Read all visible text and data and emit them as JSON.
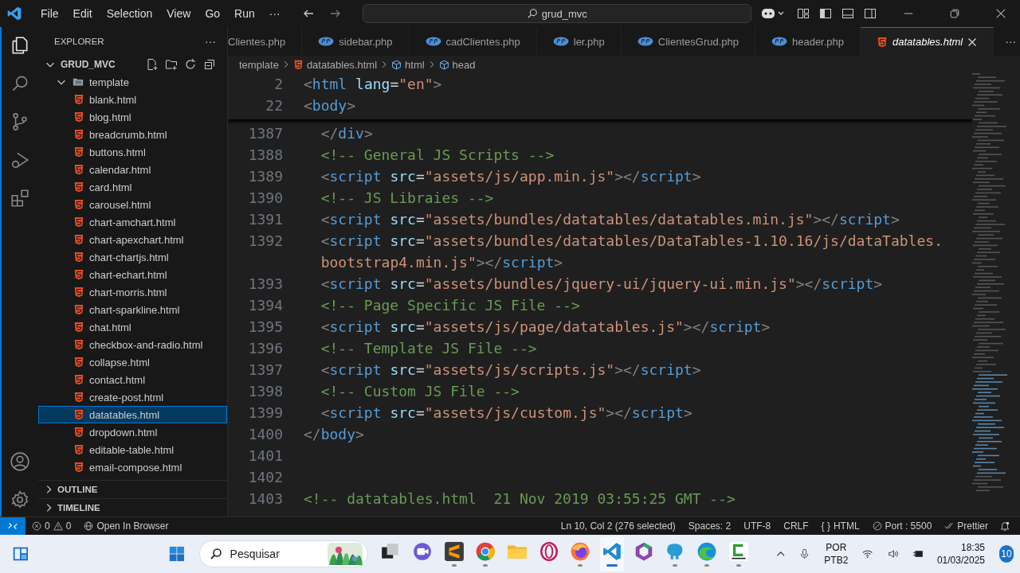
{
  "title_bar": {
    "menu": [
      "File",
      "Edit",
      "Selection",
      "View",
      "Go",
      "Run",
      "···"
    ],
    "search": "grud_mvc"
  },
  "explorer": {
    "title": "EXPLORER",
    "more": "···",
    "tree": [
      {
        "label": "GRUD_MVC",
        "kind": "root",
        "expanded": true,
        "selected": false,
        "children": [
          {
            "label": "template",
            "kind": "folder",
            "expanded": true,
            "selected": false,
            "children": [
              {
                "label": "blank.html",
                "kind": "html",
                "selected": false
              },
              {
                "label": "blog.html",
                "kind": "html",
                "selected": false
              },
              {
                "label": "breadcrumb.html",
                "kind": "html",
                "selected": false
              },
              {
                "label": "buttons.html",
                "kind": "html",
                "selected": false
              },
              {
                "label": "calendar.html",
                "kind": "html",
                "selected": false
              },
              {
                "label": "card.html",
                "kind": "html",
                "selected": false
              },
              {
                "label": "carousel.html",
                "kind": "html",
                "selected": false
              },
              {
                "label": "chart-amchart.html",
                "kind": "html",
                "selected": false
              },
              {
                "label": "chart-apexchart.html",
                "kind": "html",
                "selected": false
              },
              {
                "label": "chart-chartjs.html",
                "kind": "html",
                "selected": false
              },
              {
                "label": "chart-echart.html",
                "kind": "html",
                "selected": false
              },
              {
                "label": "chart-morris.html",
                "kind": "html",
                "selected": false
              },
              {
                "label": "chart-sparkline.html",
                "kind": "html",
                "selected": false
              },
              {
                "label": "chat.html",
                "kind": "html",
                "selected": false
              },
              {
                "label": "checkbox-and-radio.html",
                "kind": "html",
                "selected": false
              },
              {
                "label": "collapse.html",
                "kind": "html",
                "selected": false
              },
              {
                "label": "contact.html",
                "kind": "html",
                "selected": false
              },
              {
                "label": "create-post.html",
                "kind": "html",
                "selected": false
              },
              {
                "label": "datatables.html",
                "kind": "html",
                "selected": true
              },
              {
                "label": "dropdown.html",
                "kind": "html",
                "selected": false
              },
              {
                "label": "editable-table.html",
                "kind": "html",
                "selected": false
              },
              {
                "label": "email-compose.html",
                "kind": "html",
                "selected": false
              }
            ]
          }
        ]
      }
    ],
    "sections": [
      {
        "label": "OUTLINE",
        "expanded": false
      },
      {
        "label": "TIMELINE",
        "expanded": false
      }
    ]
  },
  "tabs": [
    {
      "label": "Clientes.php",
      "kind": "none",
      "selected": false,
      "preview": false
    },
    {
      "label": "sidebar.php",
      "kind": "php",
      "selected": false,
      "preview": false
    },
    {
      "label": "cadClientes.php",
      "kind": "php",
      "selected": false,
      "preview": false
    },
    {
      "label": "ler.php",
      "kind": "php",
      "selected": false,
      "preview": false
    },
    {
      "label": "ClientesGrud.php",
      "kind": "php",
      "selected": false,
      "preview": false
    },
    {
      "label": "header.php",
      "kind": "php",
      "selected": false,
      "preview": false
    },
    {
      "label": "datatables.html",
      "kind": "html",
      "selected": true,
      "preview": true
    }
  ],
  "breadcrumb": [
    {
      "label": "template",
      "kind": "folder"
    },
    {
      "label": "datatables.html",
      "kind": "html"
    },
    {
      "label": "html",
      "kind": "element"
    },
    {
      "label": "head",
      "kind": "element"
    }
  ],
  "sticky_lines": [
    {
      "number": "2",
      "tokens": [
        {
          "kind": "punct",
          "text": "<"
        },
        {
          "kind": "tag",
          "text": "html"
        },
        {
          "kind": "attr",
          "text": " lang"
        },
        {
          "kind": "plain",
          "text": "="
        },
        {
          "kind": "str",
          "text": "\"en\""
        },
        {
          "kind": "punct",
          "text": ">"
        }
      ]
    },
    {
      "number": "22",
      "tokens": [
        {
          "kind": "punct",
          "text": "<"
        },
        {
          "kind": "tag",
          "text": "body"
        },
        {
          "kind": "punct",
          "text": ">"
        }
      ]
    }
  ],
  "lines": [
    {
      "number": "1387",
      "tokens": [
        {
          "kind": "punct",
          "text": "  </"
        },
        {
          "kind": "tag",
          "text": "div"
        },
        {
          "kind": "punct",
          "text": ">"
        }
      ]
    },
    {
      "number": "1388",
      "tokens": [
        {
          "kind": "comment",
          "text": "  <!-- General JS Scripts -->"
        }
      ]
    },
    {
      "number": "1389",
      "tokens": [
        {
          "kind": "punct",
          "text": "  <"
        },
        {
          "kind": "tag",
          "text": "script"
        },
        {
          "kind": "attr",
          "text": " src"
        },
        {
          "kind": "plain",
          "text": "="
        },
        {
          "kind": "str",
          "text": "\"assets/js/app.min.js\""
        },
        {
          "kind": "punct",
          "text": "></"
        },
        {
          "kind": "tag",
          "text": "script"
        },
        {
          "kind": "punct",
          "text": ">"
        }
      ]
    },
    {
      "number": "1390",
      "tokens": [
        {
          "kind": "comment",
          "text": "  <!-- JS Libraies -->"
        }
      ]
    },
    {
      "number": "1391",
      "tokens": [
        {
          "kind": "punct",
          "text": "  <"
        },
        {
          "kind": "tag",
          "text": "script"
        },
        {
          "kind": "attr",
          "text": " src"
        },
        {
          "kind": "plain",
          "text": "="
        },
        {
          "kind": "str",
          "text": "\"assets/bundles/datatables/datatables.min.js\""
        },
        {
          "kind": "punct",
          "text": "></"
        },
        {
          "kind": "tag",
          "text": "script"
        },
        {
          "kind": "punct",
          "text": ">"
        }
      ]
    },
    {
      "number": "1392",
      "tokens": [
        {
          "kind": "punct",
          "text": "  <"
        },
        {
          "kind": "tag",
          "text": "script"
        },
        {
          "kind": "attr",
          "text": " src"
        },
        {
          "kind": "plain",
          "text": "="
        },
        {
          "kind": "str",
          "text": "\"assets/bundles/datatables/DataTables-1.10.16/js/dataTables."
        }
      ]
    },
    {
      "continuation": true,
      "tokens": [
        {
          "kind": "str",
          "text": "bootstrap4.min.js\""
        },
        {
          "kind": "punct",
          "text": "></"
        },
        {
          "kind": "tag",
          "text": "script"
        },
        {
          "kind": "punct",
          "text": ">"
        }
      ]
    },
    {
      "number": "1393",
      "tokens": [
        {
          "kind": "punct",
          "text": "  <"
        },
        {
          "kind": "tag",
          "text": "script"
        },
        {
          "kind": "attr",
          "text": " src"
        },
        {
          "kind": "plain",
          "text": "="
        },
        {
          "kind": "str",
          "text": "\"assets/bundles/jquery-ui/jquery-ui.min.js\""
        },
        {
          "kind": "punct",
          "text": "></"
        },
        {
          "kind": "tag",
          "text": "script"
        },
        {
          "kind": "punct",
          "text": ">"
        }
      ]
    },
    {
      "number": "1394",
      "tokens": [
        {
          "kind": "comment",
          "text": "  <!-- Page Specific JS File -->"
        }
      ]
    },
    {
      "number": "1395",
      "tokens": [
        {
          "kind": "punct",
          "text": "  <"
        },
        {
          "kind": "tag",
          "text": "script"
        },
        {
          "kind": "attr",
          "text": " src"
        },
        {
          "kind": "plain",
          "text": "="
        },
        {
          "kind": "str",
          "text": "\"assets/js/page/datatables.js\""
        },
        {
          "kind": "punct",
          "text": "></"
        },
        {
          "kind": "tag",
          "text": "script"
        },
        {
          "kind": "punct",
          "text": ">"
        }
      ]
    },
    {
      "number": "1396",
      "tokens": [
        {
          "kind": "comment",
          "text": "  <!-- Template JS File -->"
        }
      ]
    },
    {
      "number": "1397",
      "tokens": [
        {
          "kind": "punct",
          "text": "  <"
        },
        {
          "kind": "tag",
          "text": "script"
        },
        {
          "kind": "attr",
          "text": " src"
        },
        {
          "kind": "plain",
          "text": "="
        },
        {
          "kind": "str",
          "text": "\"assets/js/scripts.js\""
        },
        {
          "kind": "punct",
          "text": "></"
        },
        {
          "kind": "tag",
          "text": "script"
        },
        {
          "kind": "punct",
          "text": ">"
        }
      ]
    },
    {
      "number": "1398",
      "tokens": [
        {
          "kind": "comment",
          "text": "  <!-- Custom JS File -->"
        }
      ]
    },
    {
      "number": "1399",
      "tokens": [
        {
          "kind": "punct",
          "text": "  <"
        },
        {
          "kind": "tag",
          "text": "script"
        },
        {
          "kind": "attr",
          "text": " src"
        },
        {
          "kind": "plain",
          "text": "="
        },
        {
          "kind": "str",
          "text": "\"assets/js/custom.js\""
        },
        {
          "kind": "punct",
          "text": "></"
        },
        {
          "kind": "tag",
          "text": "script"
        },
        {
          "kind": "punct",
          "text": ">"
        }
      ]
    },
    {
      "number": "1400",
      "tokens": [
        {
          "kind": "punct",
          "text": "</"
        },
        {
          "kind": "tag",
          "text": "body"
        },
        {
          "kind": "punct",
          "text": ">"
        }
      ]
    },
    {
      "number": "1401"
    },
    {
      "number": "1402"
    },
    {
      "number": "1403",
      "tokens": [
        {
          "kind": "comment",
          "text": "<!-- datatables.html  21 Nov 2019 03:55:25 GMT -->"
        }
      ]
    }
  ],
  "status_bar": {
    "errors": "0",
    "warnings": "0",
    "open_in_browser": "Open In Browser",
    "right": [
      {
        "label": "Ln 10, Col 2 (276 selected)",
        "kind": "text"
      },
      {
        "label": "Spaces: 2",
        "kind": "text"
      },
      {
        "label": "UTF-8",
        "kind": "text"
      },
      {
        "label": "CRLF",
        "kind": "text"
      },
      {
        "label": "HTML",
        "kind": "braces",
        "prefix": "{ }"
      },
      {
        "label": "Port : 5500",
        "kind": "port"
      },
      {
        "label": "Prettier",
        "kind": "check"
      }
    ]
  },
  "taskbar": {
    "search": {
      "placeholder": "Pesquisar"
    },
    "apps": [
      {
        "kind": "taskview",
        "running": false,
        "selected": false
      },
      {
        "kind": "meet",
        "running": false,
        "selected": false
      },
      {
        "kind": "sublime",
        "running": true,
        "selected": false
      },
      {
        "kind": "chrome",
        "running": true,
        "selected": false
      },
      {
        "kind": "folder",
        "running": false,
        "selected": false
      },
      {
        "kind": "opera",
        "running": false,
        "selected": false
      },
      {
        "kind": "firefox",
        "running": true,
        "selected": false
      },
      {
        "kind": "vscode",
        "running": true,
        "selected": true
      },
      {
        "kind": "hexagon",
        "running": false,
        "selected": false
      },
      {
        "kind": "elephant",
        "running": true,
        "selected": false
      },
      {
        "kind": "edge",
        "running": true,
        "selected": false
      },
      {
        "kind": "camtasia",
        "running": true,
        "selected": false
      }
    ],
    "language": [
      "POR",
      "PTB2"
    ],
    "time": "18:35",
    "date": "01/03/2025",
    "badge": "10"
  }
}
